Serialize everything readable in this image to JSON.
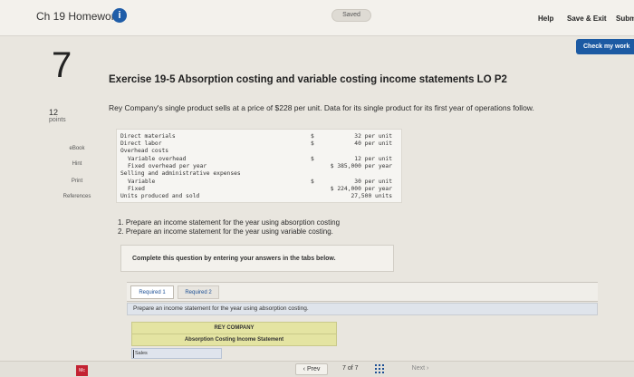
{
  "header": {
    "homework_title": "Ch 19 Homework",
    "info_glyph": "i",
    "status": "Saved",
    "help": "Help",
    "save_exit": "Save & Exit",
    "submit": "Subm"
  },
  "check_button": "Check my work",
  "question": {
    "number": "7",
    "title": "Exercise 19-5 Absorption costing and variable costing income statements LO P2",
    "points_value": "12",
    "points_label": "points",
    "intro": "Rey Company's single product sells at a price of $228 per unit. Data for its single product for its first year of operations follow."
  },
  "sidebar": {
    "ebook": "eBook",
    "hint": "Hint",
    "print": "Print",
    "references": "References"
  },
  "data_table": {
    "rows": [
      {
        "label": "Direct materials",
        "dollar": "$",
        "value": "32 per unit"
      },
      {
        "label": "Direct labor",
        "dollar": "$",
        "value": "40 per unit"
      },
      {
        "label": "Overhead costs",
        "dollar": "",
        "value": ""
      },
      {
        "label": "  Variable overhead",
        "dollar": "$",
        "value": "12 per unit"
      },
      {
        "label": "  Fixed overhead per year",
        "dollar": "",
        "value": "$ 385,000 per year"
      },
      {
        "label": "Selling and administrative expenses",
        "dollar": "",
        "value": ""
      },
      {
        "label": "  Variable",
        "dollar": "$",
        "value": "30 per unit"
      },
      {
        "label": "  Fixed",
        "dollar": "",
        "value": "$ 224,000 per year"
      },
      {
        "label": "Units produced and sold",
        "dollar": "",
        "value": "27,500 units"
      }
    ]
  },
  "instructions": {
    "item1": "1. Prepare an income statement for the year using absorption costing",
    "item2": "2. Prepare an income statement for the year using variable costing."
  },
  "complete_prompt": "Complete this question by entering your answers in the tabs below.",
  "tabs": {
    "required1": "Required 1",
    "required2": "Required 2"
  },
  "tab_prompt": "Prepare an income statement for the year using absorption costing.",
  "statement": {
    "company": "REY COMPANY",
    "subtitle": "Absorption Costing Income Statement",
    "sales_label": "Sales"
  },
  "footer": {
    "logo": "Mc",
    "prev": "Prev",
    "page_current": "7",
    "page_of": "of",
    "page_total": "7",
    "next": "Next"
  },
  "colors": {
    "accent_blue": "#1c5aa3",
    "statement_header": "#e4e4a2",
    "logo_red": "#c32232"
  }
}
